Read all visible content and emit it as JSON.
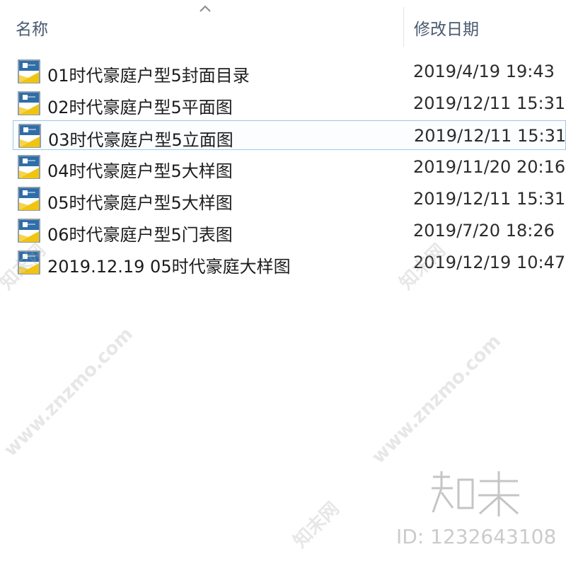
{
  "header": {
    "name_label": "名称",
    "date_label": "修改日期"
  },
  "files": [
    {
      "name": "01时代豪庭户型5封面目录",
      "date": "2019/4/19 19:43",
      "icon": "cad-drawing-icon"
    },
    {
      "name": "02时代豪庭户型5平面图",
      "date": "2019/12/11 15:31",
      "icon": "cad-drawing-icon"
    },
    {
      "name": "03时代豪庭户型5立面图",
      "date": "2019/12/11 15:31",
      "icon": "cad-drawing-icon",
      "selected": true
    },
    {
      "name": "04时代豪庭户型5大样图",
      "date": "2019/11/20 20:16",
      "icon": "cad-drawing-icon"
    },
    {
      "name": "05时代豪庭户型5大样图",
      "date": "2019/12/11 15:31",
      "icon": "cad-drawing-icon"
    },
    {
      "name": "06时代豪庭户型5门表图",
      "date": "2019/7/20 18:26",
      "icon": "cad-drawing-icon"
    },
    {
      "name": "2019.12.19 05时代豪庭大样图",
      "date": "2019/12/19 10:47",
      "icon": "cad-drawing-icon"
    }
  ],
  "watermark": {
    "site": "www.znzmo.com",
    "brand_cn": "知末网",
    "logo": "知末",
    "id_text": "ID: 1232643108"
  },
  "colors": {
    "selection_border": "#9ec7ea",
    "header_text": "#4a5a70"
  }
}
